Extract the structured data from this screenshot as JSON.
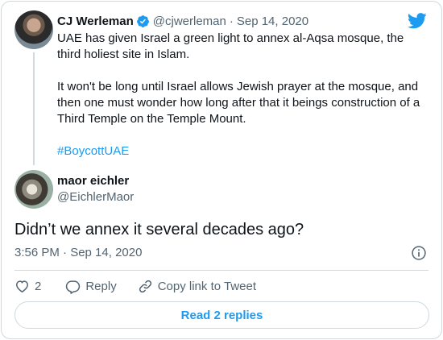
{
  "parent_tweet": {
    "author_name": "CJ Werleman",
    "handle": "@cjwerleman",
    "separator": "·",
    "date": "Sep 14, 2020",
    "text_p1": "UAE has given Israel a green light to annex al-Aqsa mosque, the third holiest site in Islam.",
    "text_p2": "It won't be long until Israel allows Jewish prayer at the mosque, and then one must wonder how long after that it beings construction of a Third Temple on the Temple Mount.",
    "hashtag": "#BoycottUAE"
  },
  "main_tweet": {
    "author_name": "maor eichler",
    "handle": "@EichlerMaor",
    "text": "Didn’t we annex it several decades ago?",
    "timestamp": "3:56 PM · Sep 14, 2020"
  },
  "actions": {
    "like_count": "2",
    "reply_label": "Reply",
    "copy_link_label": "Copy link to Tweet"
  },
  "read_replies_label": "Read 2 replies",
  "colors": {
    "accent": "#1d9bf0",
    "secondary_text": "#536471",
    "border": "#cfd9de"
  },
  "icons": [
    "verified-badge-icon",
    "twitter-bird-icon",
    "info-icon",
    "heart-icon",
    "reply-icon",
    "link-icon"
  ]
}
